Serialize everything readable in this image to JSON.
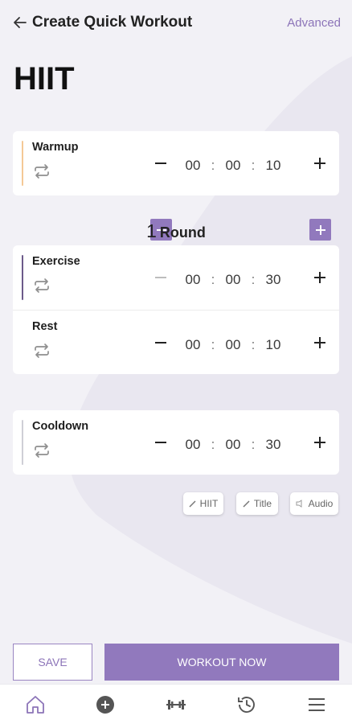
{
  "header": {
    "title": "Create Quick Workout",
    "advanced_label": "Advanced"
  },
  "workout_name": "HIIT",
  "warmup": {
    "label": "Warmup",
    "hours": "00",
    "minutes": "00",
    "seconds": "10",
    "accent": "#f4c996"
  },
  "rounds": {
    "count": "1",
    "unit": "Round"
  },
  "exercise": {
    "label": "Exercise",
    "hours": "00",
    "minutes": "00",
    "seconds": "30",
    "accent": "#6c5a8a"
  },
  "rest": {
    "label": "Rest",
    "hours": "00",
    "minutes": "00",
    "seconds": "10",
    "accent": "#ffffff"
  },
  "cooldown": {
    "label": "Cooldown",
    "hours": "00",
    "minutes": "00",
    "seconds": "30",
    "accent": "#cfcfd6"
  },
  "separators": [
    ":",
    ":"
  ],
  "chips": {
    "hiit": "HIIT",
    "title": "Title",
    "audio": "Audio"
  },
  "actions": {
    "save": "SAVE",
    "workout_now": "WORKOUT NOW"
  },
  "colors": {
    "accent": "#9179bd",
    "background": "#f2f1f6"
  },
  "nav": [
    "home-icon",
    "add-circle-icon",
    "dumbbell-icon",
    "history-icon",
    "menu-icon"
  ]
}
